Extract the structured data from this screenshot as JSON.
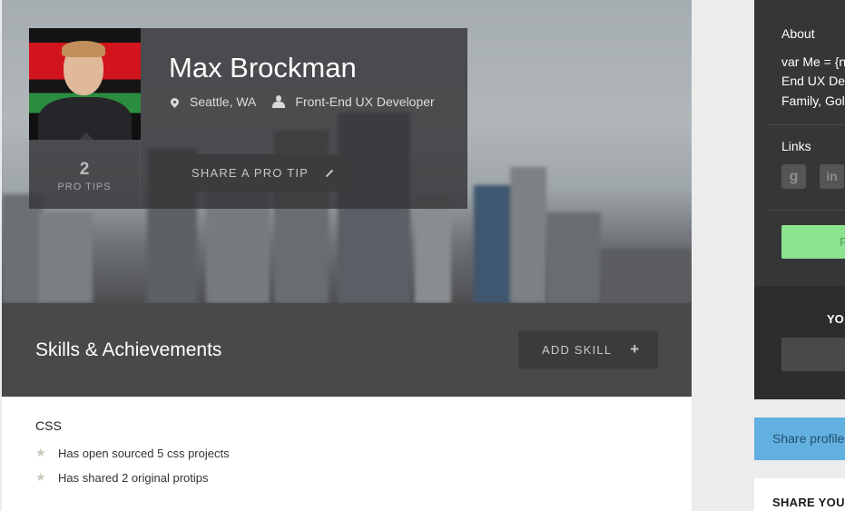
{
  "profile": {
    "name": "Max Brockman",
    "location": "Seattle, WA",
    "title": "Front-End UX Developer",
    "protips_count": "2",
    "protips_label": "PRO TIPS",
    "share_protip_label": "SHARE A PRO TIP"
  },
  "skills_section": {
    "title": "Skills & Achievements",
    "add_skill_label": "ADD SKILL",
    "skills": [
      {
        "name": "CSS",
        "achievements": [
          "Has open sourced 5 css projects",
          "Has shared 2 original protips"
        ]
      }
    ]
  },
  "sidebar": {
    "about_label": "About",
    "about_lines": [
      "var Me = {n",
      "End UX Dev",
      "Family, Gol"
    ],
    "links_label": "Links",
    "social_icons": [
      "google-plus-icon",
      "linkedin-icon"
    ],
    "social_glyphs": [
      "g",
      "in"
    ],
    "follow_label": "F",
    "yo_label": "YO",
    "select_chevron": "∨",
    "share_profile_label": "Share profile",
    "share_panel_title": "SHARE YOUR"
  },
  "colors": {
    "follow_green": "#8be38e",
    "share_blue": "#62b0e0",
    "dark_panel": "#353638",
    "skills_bar": "#48494b"
  }
}
